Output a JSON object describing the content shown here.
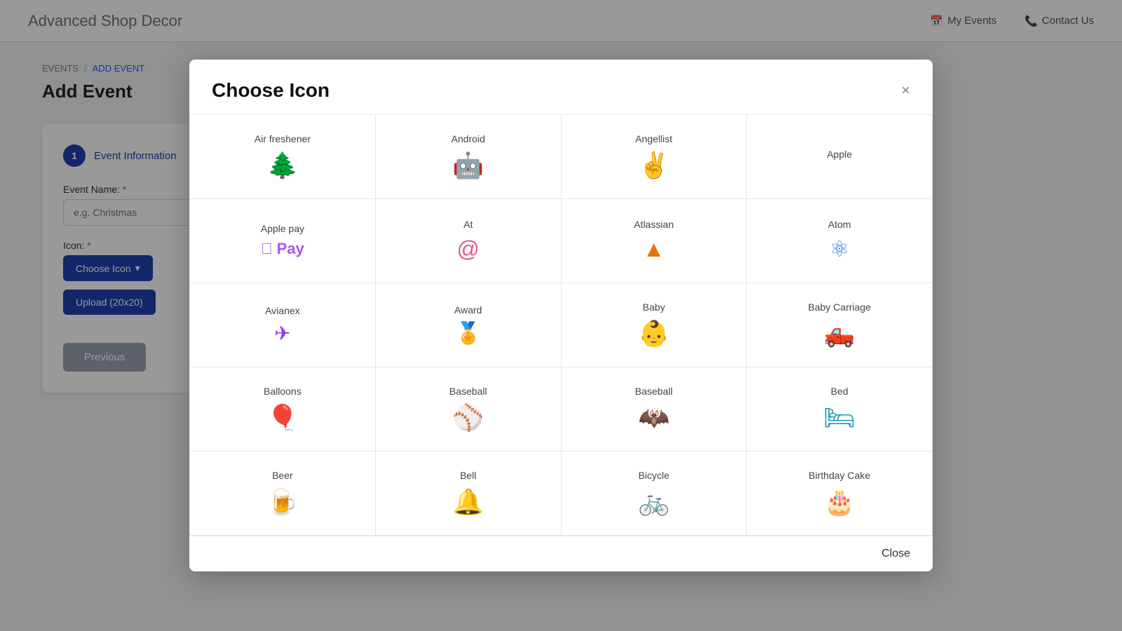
{
  "app": {
    "name_bold": "Advanced",
    "name_light": " Shop Decor"
  },
  "nav": {
    "links": [
      {
        "icon": "calendar-icon",
        "label": "My Events"
      },
      {
        "icon": "phone-icon",
        "label": "Contact Us"
      }
    ]
  },
  "breadcrumb": {
    "root": "EVENTS",
    "separator": "/",
    "current": "ADD EVENT"
  },
  "page": {
    "title": "Add Event"
  },
  "form": {
    "step_number": "1",
    "step_label": "Event Information",
    "event_name_label": "Event Name:",
    "event_name_placeholder": "e.g. Christmas",
    "icon_label": "Icon:",
    "choose_icon_btn": "Choose Icon",
    "upload_btn": "Upload (20x20)",
    "previous_btn": "Previous"
  },
  "modal": {
    "title": "Choose Icon",
    "close_btn": "×",
    "footer_close": "Close",
    "icons": [
      {
        "name": "Air freshener",
        "symbol": "🌲",
        "color": "#4a90d9"
      },
      {
        "name": "Android",
        "symbol": "🤖",
        "color": "#78c940"
      },
      {
        "name": "Angellist",
        "symbol": "✌️",
        "color": "#e8a020"
      },
      {
        "name": "Apple",
        "symbol": "",
        "color": "#111"
      },
      {
        "name": "Apple pay",
        "symbol": " Pay",
        "color": "#a855f7",
        "is_text": true
      },
      {
        "name": "At",
        "symbol": "@",
        "color": "#e05a8a"
      },
      {
        "name": "Atlassian",
        "symbol": "▲",
        "color": "#e8720c"
      },
      {
        "name": "Atom",
        "symbol": "⚛",
        "color": "#3b82f6"
      },
      {
        "name": "Avianex",
        "symbol": "✈",
        "color": "#9333ea"
      },
      {
        "name": "Award",
        "symbol": "🏅",
        "color": "#16a34a"
      },
      {
        "name": "Baby",
        "symbol": "👶",
        "color": "#9333ea"
      },
      {
        "name": "Baby Carriage",
        "symbol": "🛻",
        "color": "#f97316"
      },
      {
        "name": "Balloons",
        "symbol": "🎈",
        "color": "#e53e3e"
      },
      {
        "name": "Baseball",
        "symbol": "⚾",
        "color": "#e05a8a"
      },
      {
        "name": "Baseball",
        "symbol": "🦇",
        "color": "#9333ea"
      },
      {
        "name": "Bed",
        "symbol": "🛏",
        "color": "#0891b2"
      },
      {
        "name": "Beer",
        "symbol": "🍺",
        "color": "#f59e0b"
      },
      {
        "name": "Bell",
        "symbol": "🔔",
        "color": "#e05a8a"
      },
      {
        "name": "Bicycle",
        "symbol": "🚲",
        "color": "#9333ea"
      },
      {
        "name": "Birthday Cake",
        "symbol": "🎂",
        "color": "#e05a8a"
      }
    ]
  }
}
